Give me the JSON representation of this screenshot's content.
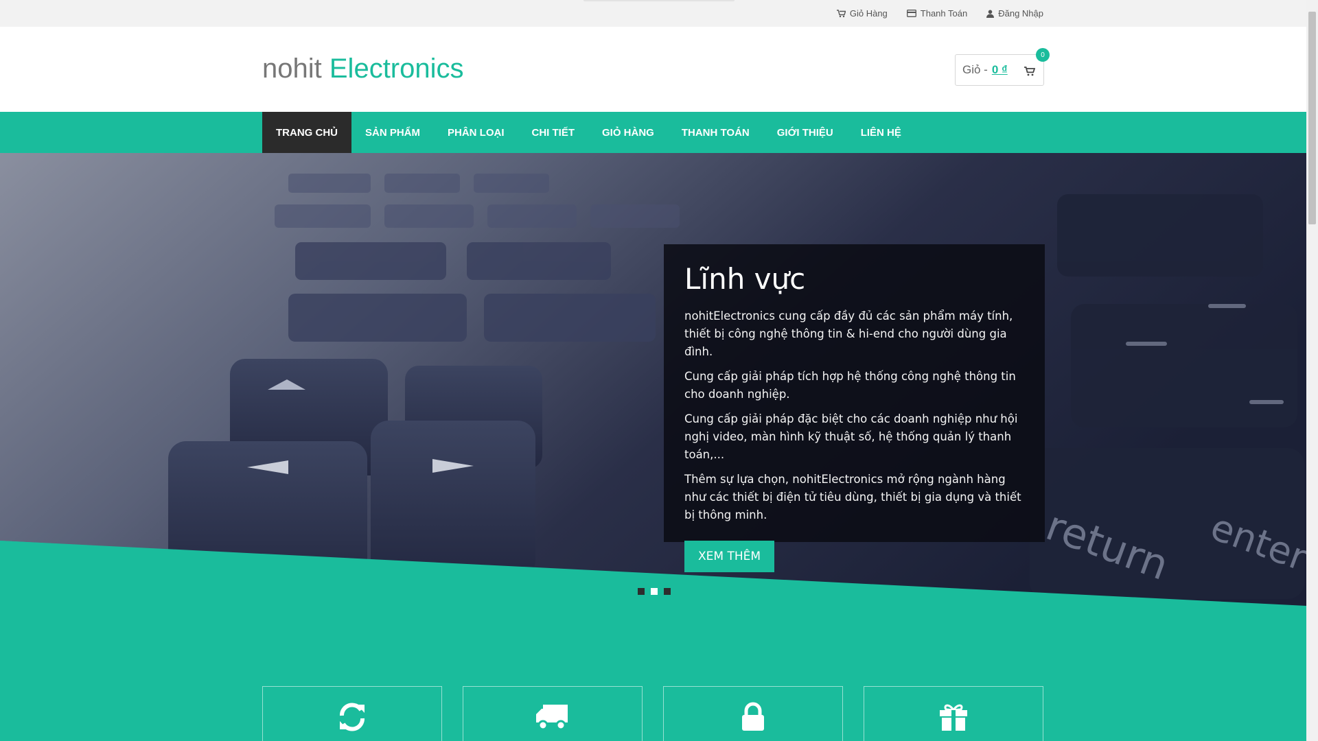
{
  "topbar": {
    "links": [
      {
        "label": "Giỏ Hàng",
        "icon": "cart-icon"
      },
      {
        "label": "Thanh Toán",
        "icon": "credit-card-icon"
      },
      {
        "label": "Đăng Nhập",
        "icon": "user-icon"
      }
    ]
  },
  "header": {
    "logo_part1": "nohit",
    "logo_part2": "Electronics",
    "cart_label": "Giỏ -",
    "cart_amount": "0 ₫",
    "cart_count": "0"
  },
  "nav": {
    "items": [
      {
        "label": "TRANG CHỦ",
        "active": true
      },
      {
        "label": "SẢN PHẨM",
        "active": false
      },
      {
        "label": "PHÂN LOẠI",
        "active": false
      },
      {
        "label": "CHI TIẾT",
        "active": false
      },
      {
        "label": "GIỎ HÀNG",
        "active": false
      },
      {
        "label": "THANH TOÁN",
        "active": false
      },
      {
        "label": "GIỚI THIỆU",
        "active": false
      },
      {
        "label": "LIÊN HỆ",
        "active": false
      }
    ]
  },
  "hero": {
    "title": "Lĩnh vực",
    "paragraphs": [
      "nohitElectronics cung cấp đầy đủ các sản phẩm máy tính, thiết bị công nghệ thông tin & hi-end cho người dùng gia đình.",
      "Cung cấp giải pháp tích hợp hệ thống công nghệ thông tin cho doanh nghiệp.",
      "Cung cấp giải pháp đặc biệt cho các doanh nghiệp như hội nghị video, màn hình kỹ thuật số, hệ thống quản lý thanh toán,...",
      "Thêm sự lựa chọn, nohitElectronics mở rộng ngành hàng như các thiết bị điện tử tiêu dùng, thiết bị gia dụng và thiết bị thông minh."
    ],
    "button_label": "XEM THÊM",
    "active_slide": 2,
    "slide_count": 3
  },
  "features": [
    {
      "icon": "refresh-icon"
    },
    {
      "icon": "truck-icon"
    },
    {
      "icon": "lock-icon"
    },
    {
      "icon": "gift-icon"
    }
  ],
  "colors": {
    "accent": "#1abc9c",
    "nav_active": "#2b2b2b",
    "topbar_bg": "#f2f2f2"
  }
}
